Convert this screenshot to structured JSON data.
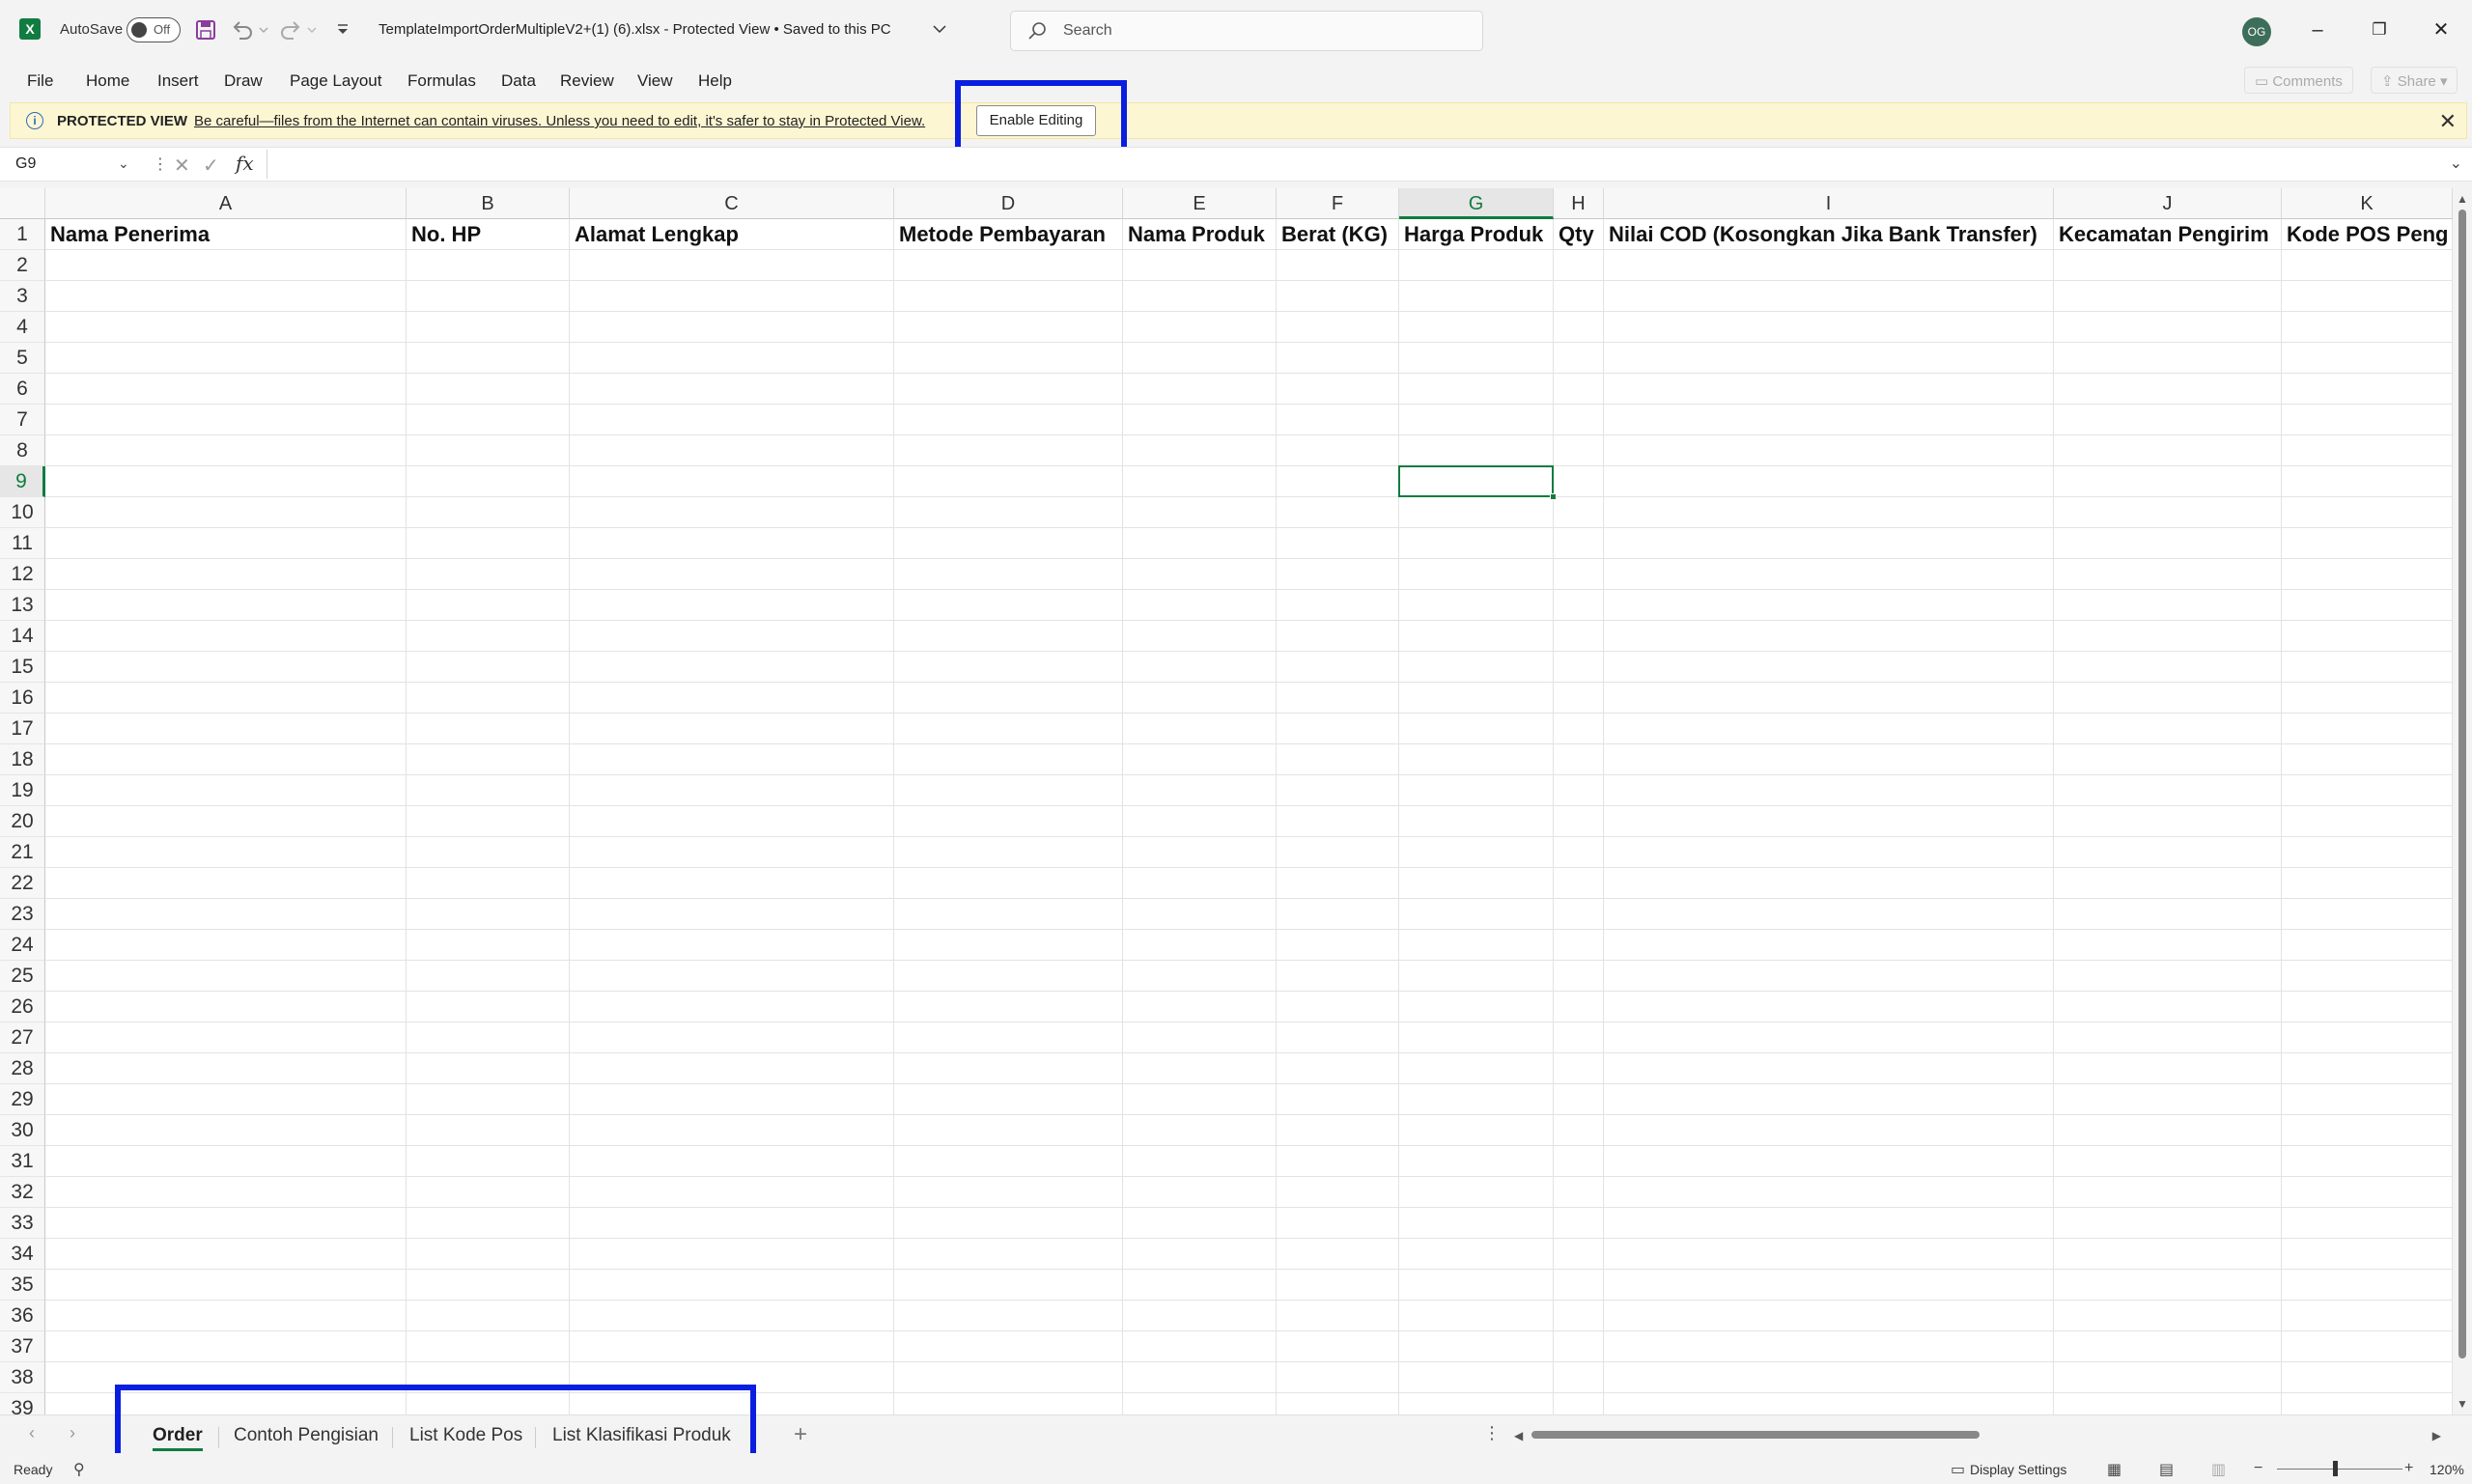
{
  "app": {
    "logo_letter": "X",
    "autosave_label": "AutoSave",
    "autosave_state": "Off",
    "doc_title": "TemplateImportOrderMultipleV2+(1) (6).xlsx  -  Protected View • Saved to this PC",
    "search_placeholder": "Search",
    "avatar_initials": "OG",
    "minimize": "–",
    "restore": "❐",
    "close": "✕"
  },
  "menu": {
    "items": [
      "File",
      "Home",
      "Insert",
      "Draw",
      "Page Layout",
      "Formulas",
      "Data",
      "Review",
      "View",
      "Help"
    ],
    "comments": "Comments",
    "share": "Share"
  },
  "protected_view": {
    "title": "PROTECTED VIEW",
    "message": "Be careful—files from the Internet can contain viruses. Unless you need to edit, it's safer to stay in Protected View.",
    "button": "Enable Editing",
    "close": "✕"
  },
  "formula_bar": {
    "name_box": "G9",
    "fx": "fx",
    "cancel": "✕",
    "enter": "✓",
    "value": ""
  },
  "sheet": {
    "columns": [
      "A",
      "B",
      "C",
      "D",
      "E",
      "F",
      "G",
      "H",
      "I",
      "J",
      "K"
    ],
    "selected_column": "G",
    "headers": [
      "Nama Penerima",
      "No. HP",
      "Alamat Lengkap",
      "Metode Pembayaran",
      "Nama Produk",
      "Berat (KG)",
      "Harga Produk",
      "Qty",
      "Nilai COD (Kosongkan Jika Bank Transfer)",
      "Kecamatan Pengirim",
      "Kode POS Peng"
    ],
    "row_numbers": [
      "1",
      "2",
      "3",
      "4",
      "5",
      "6",
      "7",
      "8",
      "9",
      "10",
      "11",
      "12",
      "13",
      "14",
      "15",
      "16",
      "17",
      "18",
      "19",
      "20",
      "21",
      "22",
      "23",
      "24",
      "25",
      "26",
      "27",
      "28",
      "29",
      "30",
      "31",
      "32",
      "33",
      "34",
      "35",
      "36",
      "37",
      "38",
      "39"
    ],
    "selected_row": "9",
    "active_cell": "G9"
  },
  "tabs": {
    "items": [
      "Order",
      "Contoh Pengisian",
      "List Kode Pos",
      "List Klasifikasi Produk"
    ],
    "active": "Order",
    "add": "+"
  },
  "status": {
    "ready": "Ready",
    "display_settings": "Display Settings",
    "zoom": "120%"
  },
  "highlight_color": "#0a1ee0",
  "accent_color": "#107c41"
}
